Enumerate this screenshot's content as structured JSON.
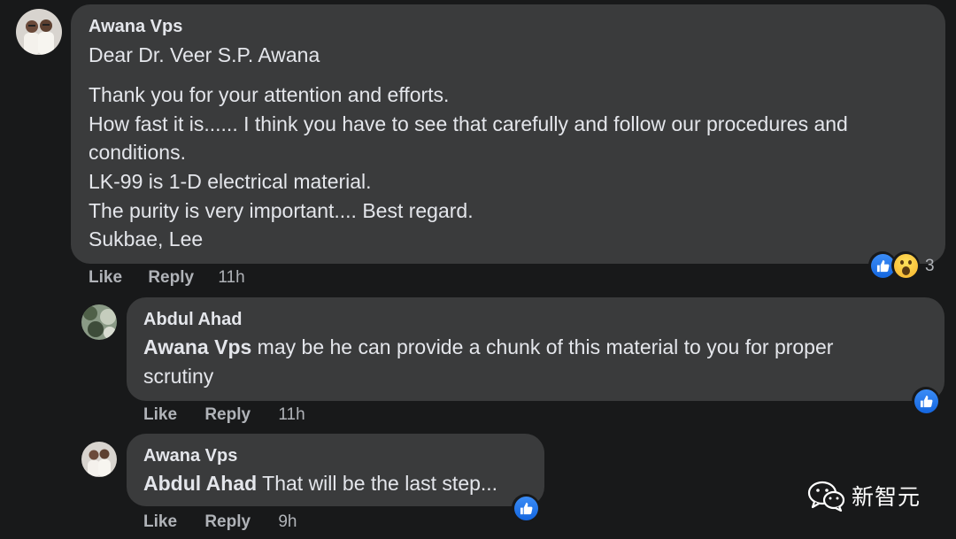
{
  "comments": [
    {
      "author": "Awana Vps",
      "lines": [
        "Dear Dr. Veer S.P. Awana",
        "Thank you for your attention and efforts.",
        "How fast it is...... I think you have to see that carefully and follow our procedures and",
        "conditions.",
        "LK-99 is 1-D electrical material.",
        "The purity is very important.... Best regard.",
        "Sukbae, Lee"
      ],
      "actions": {
        "like": "Like",
        "reply": "Reply",
        "time": "11h"
      },
      "reactions": {
        "icons": [
          "like-icon",
          "wow-icon"
        ],
        "count": "3"
      }
    },
    {
      "author": "Abdul Ahad",
      "mention": "Awana Vps",
      "lines": [
        " may be he can provide a chunk of this material to you for proper",
        "scrutiny"
      ],
      "actions": {
        "like": "Like",
        "reply": "Reply",
        "time": "11h"
      },
      "reactions": {
        "icons": [
          "like-icon"
        ]
      }
    },
    {
      "author": "Awana Vps",
      "mention": "Abdul Ahad",
      "lines": [
        " That will be the last step..."
      ],
      "actions": {
        "like": "Like",
        "reply": "Reply",
        "time": "9h"
      },
      "reactions": {
        "icons": [
          "like-icon"
        ]
      }
    }
  ],
  "watermark": {
    "text": "新智元",
    "icon": "wechat-icon"
  },
  "colors": {
    "background": "#18191a",
    "bubble": "#3a3b3c",
    "text": "#e4e6eb",
    "muted": "#b0b3b8",
    "like_blue": "#1877f2"
  }
}
